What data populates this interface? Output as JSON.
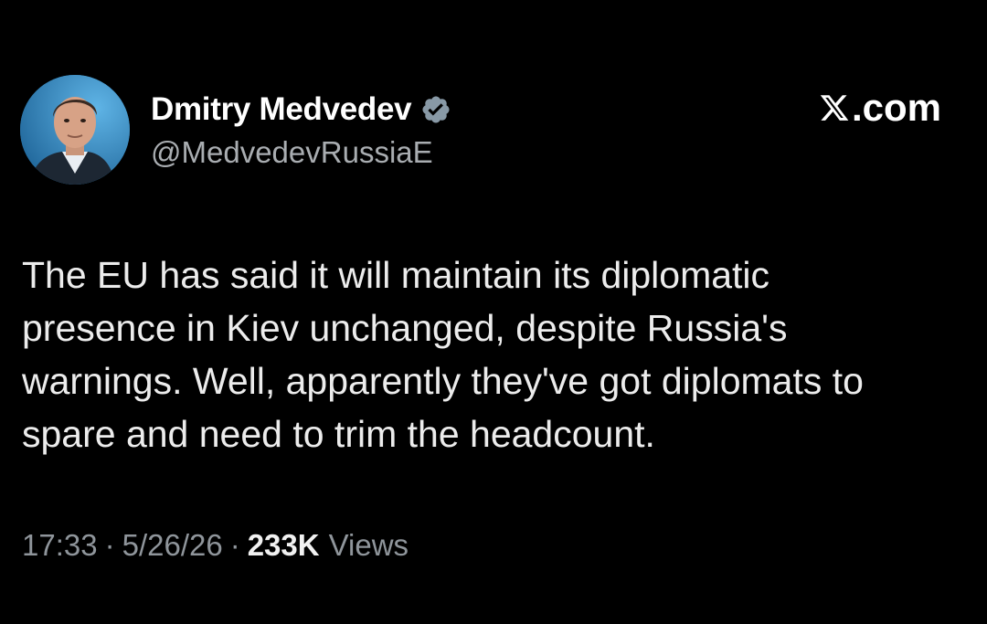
{
  "author": {
    "display_name": "Dmitry Medvedev",
    "handle": "@MedvedevRussiaE",
    "avatar_icon": "profile-photo",
    "verified_icon": "verified-badge-icon"
  },
  "brand": {
    "icon": "x-logo-icon",
    "text": ".com"
  },
  "tweet": {
    "text": "The EU has said it will maintain its diplomatic\npresence in Kiev unchanged, despite Russia's\nwarnings. Well, apparently they've got diplomats to\nspare and need to trim the headcount."
  },
  "meta": {
    "time": "17:33",
    "separator": "·",
    "date": "5/26/26",
    "views_count": "233K",
    "views_label": "Views"
  },
  "colors": {
    "background": "#000000",
    "text": "#e7e9ea",
    "secondary": "#8f959b",
    "verified": "#8899a6"
  }
}
